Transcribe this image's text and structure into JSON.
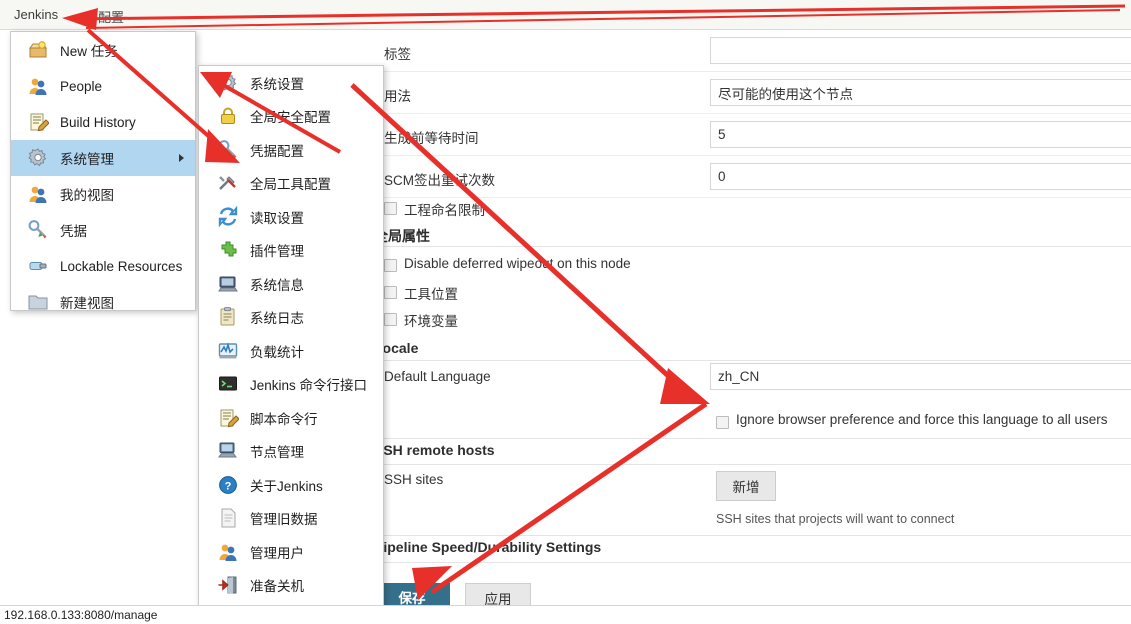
{
  "window": {
    "status_url": "192.168.0.133:8080/manage"
  },
  "breadcrumb": {
    "root": "Jenkins",
    "current": "配置"
  },
  "colors": {
    "menu_selected": "#b1d7f0",
    "save_button": "#35708a",
    "annotation_arrow": "#e8302a",
    "breadcrumb_bar": "#f7f7f4"
  },
  "main_menu": {
    "items": [
      {
        "label": "New 任务",
        "icon": "new-job-icon",
        "selected": false,
        "has_submenu": false
      },
      {
        "label": "People",
        "icon": "people-icon",
        "selected": false,
        "has_submenu": false
      },
      {
        "label": "Build History",
        "icon": "build-history-icon",
        "selected": false,
        "has_submenu": false
      },
      {
        "label": "系统管理",
        "icon": "gear-icon",
        "selected": true,
        "has_submenu": true
      },
      {
        "label": "我的视图",
        "icon": "my-views-icon",
        "selected": false,
        "has_submenu": false
      },
      {
        "label": "凭据",
        "icon": "credentials-icon",
        "selected": false,
        "has_submenu": false
      },
      {
        "label": "Lockable Resources",
        "icon": "lock-resource-icon",
        "selected": false,
        "has_submenu": false
      },
      {
        "label": "新建视图",
        "icon": "new-view-icon",
        "selected": false,
        "has_submenu": false
      }
    ]
  },
  "sub_menu": {
    "items": [
      {
        "label": "系统设置",
        "icon": "gear-icon"
      },
      {
        "label": "全局安全配置",
        "icon": "lock-icon"
      },
      {
        "label": "凭据配置",
        "icon": "credentials-icon"
      },
      {
        "label": "全局工具配置",
        "icon": "tools-icon"
      },
      {
        "label": "读取设置",
        "icon": "reload-icon"
      },
      {
        "label": "插件管理",
        "icon": "plugin-icon"
      },
      {
        "label": "系统信息",
        "icon": "computer-icon"
      },
      {
        "label": "系统日志",
        "icon": "clipboard-icon"
      },
      {
        "label": "负载统计",
        "icon": "load-statistics-icon"
      },
      {
        "label": "Jenkins 命令行接口",
        "icon": "terminal-icon"
      },
      {
        "label": "脚本命令行",
        "icon": "script-console-icon"
      },
      {
        "label": "节点管理",
        "icon": "nodes-icon"
      },
      {
        "label": "关于Jenkins",
        "icon": "question-icon"
      },
      {
        "label": "管理旧数据",
        "icon": "document-icon"
      },
      {
        "label": "管理用户",
        "icon": "users-icon"
      },
      {
        "label": "准备关机",
        "icon": "shutdown-icon"
      }
    ]
  },
  "form": {
    "rows": [
      {
        "label": "标签",
        "value": ""
      },
      {
        "label": "用法",
        "value": "尽可能的使用这个节点"
      },
      {
        "label": "生成前等待时间",
        "value": "5"
      },
      {
        "label": "SCM签出重试次数",
        "value": "0"
      }
    ],
    "project_naming_checkbox": {
      "label": "工程命名限制",
      "checked": false
    },
    "global_properties": {
      "heading": "全局属性",
      "checkboxes": [
        {
          "label": "Disable deferred wipeout on this node",
          "checked": false
        },
        {
          "label": "工具位置",
          "checked": false
        },
        {
          "label": "环境变量",
          "checked": false
        }
      ]
    },
    "locale": {
      "heading": "Locale",
      "default_language_label": "Default Language",
      "default_language_value": "zh_CN",
      "ignore_browser_label": "Ignore browser preference and force this language to all users",
      "ignore_browser_checked": false
    },
    "ssh_remote_hosts": {
      "heading": "SSH remote hosts",
      "sites_label": "SSH sites",
      "add_button": "新增",
      "hint": "SSH sites that projects will want to connect"
    },
    "pipeline": {
      "heading": "Pipeline Speed/Durability Settings"
    },
    "actions": {
      "save": "保存",
      "apply": "应用"
    }
  }
}
